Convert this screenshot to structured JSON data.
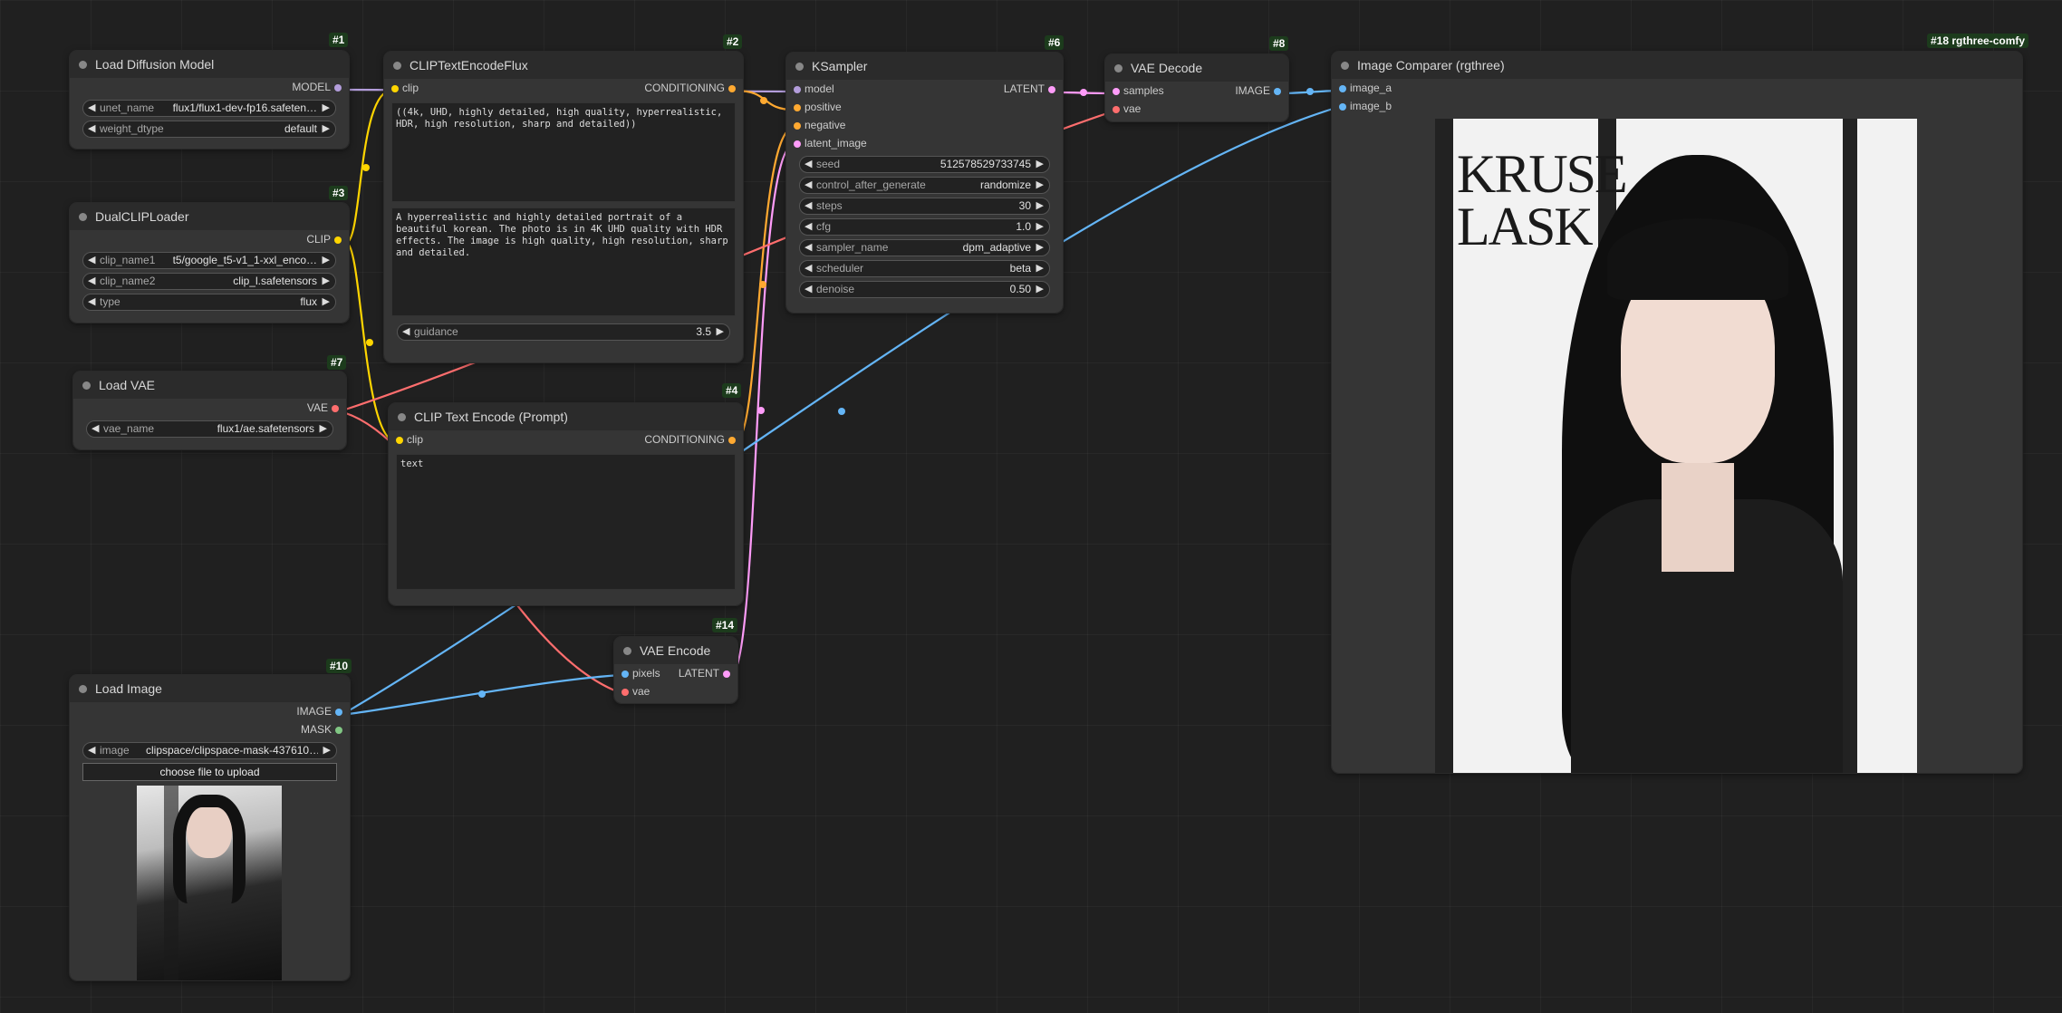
{
  "colors": {
    "model": "#b39ddb",
    "clip": "#ffd500",
    "conditioning": "#ffa931",
    "latent": "#ff9cf9",
    "vae": "#ff6e6e",
    "image": "#64b5f6",
    "mask": "#81c784"
  },
  "nodes": {
    "load_diffusion": {
      "id": "#1",
      "title": "Load Diffusion Model",
      "out": "MODEL",
      "widgets": [
        {
          "label": "unet_name",
          "value": "flux1/flux1-dev-fp16.safeten…"
        },
        {
          "label": "weight_dtype",
          "value": "default"
        }
      ]
    },
    "clip_flux": {
      "id": "#2",
      "title": "CLIPTextEncodeFlux",
      "in": "clip",
      "out": "CONDITIONING",
      "text1": "((4k, UHD, highly detailed, high quality, hyperrealistic, HDR, high resolution, sharp and detailed))",
      "text2": "A hyperrealistic and highly detailed portrait of a beautiful korean. The photo is in 4K UHD quality with HDR effects. The image is high quality, high resolution, sharp and detailed.",
      "widgets": [
        {
          "label": "guidance",
          "value": "3.5"
        }
      ]
    },
    "dual_clip": {
      "id": "#3",
      "title": "DualCLIPLoader",
      "out": "CLIP",
      "widgets": [
        {
          "label": "clip_name1",
          "value": "t5/google_t5-v1_1-xxl_enco…"
        },
        {
          "label": "clip_name2",
          "value": "clip_l.safetensors"
        },
        {
          "label": "type",
          "value": "flux"
        }
      ]
    },
    "load_vae": {
      "id": "#7",
      "title": "Load VAE",
      "out": "VAE",
      "widgets": [
        {
          "label": "vae_name",
          "value": "flux1/ae.safetensors"
        }
      ]
    },
    "clip_text": {
      "id": "#4",
      "title": "CLIP Text Encode (Prompt)",
      "in": "clip",
      "out": "CONDITIONING",
      "text": "text"
    },
    "ksampler": {
      "id": "#6",
      "title": "KSampler",
      "out": "LATENT",
      "inputs": [
        "model",
        "positive",
        "negative",
        "latent_image"
      ],
      "widgets": [
        {
          "label": "seed",
          "value": "512578529733745"
        },
        {
          "label": "control_after_generate",
          "value": "randomize"
        },
        {
          "label": "steps",
          "value": "30"
        },
        {
          "label": "cfg",
          "value": "1.0"
        },
        {
          "label": "sampler_name",
          "value": "dpm_adaptive"
        },
        {
          "label": "scheduler",
          "value": "beta"
        },
        {
          "label": "denoise",
          "value": "0.50"
        }
      ]
    },
    "vae_decode": {
      "id": "#8",
      "title": "VAE Decode",
      "in1": "samples",
      "in2": "vae",
      "out": "IMAGE"
    },
    "image_comparer": {
      "id": "#18 rgthree-comfy",
      "title": "Image Comparer (rgthree)",
      "in1": "image_a",
      "in2": "image_b",
      "poster_text": "KRUSE\nLASK"
    },
    "vae_encode": {
      "id": "#14",
      "title": "VAE Encode",
      "in1": "pixels",
      "in2": "vae",
      "out": "LATENT"
    },
    "load_image": {
      "id": "#10",
      "title": "Load Image",
      "out1": "IMAGE",
      "out2": "MASK",
      "widgets": [
        {
          "label": "image",
          "value": "clipspace/clipspace-mask-437610…"
        }
      ],
      "button": "choose file to upload"
    }
  }
}
